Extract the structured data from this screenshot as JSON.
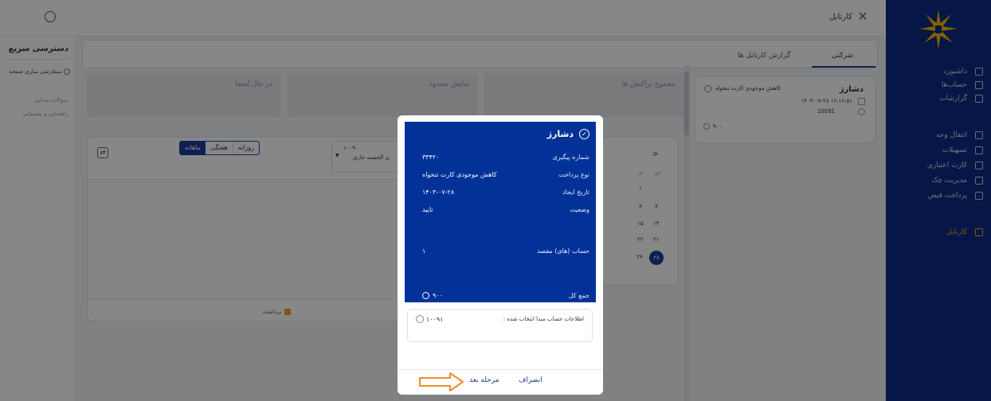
{
  "header": {
    "title": "کارتابل"
  },
  "nav": {
    "items": [
      {
        "label": "داشبورد",
        "icon": "dashboard-icon"
      },
      {
        "label": "حساب‌ها",
        "icon": "bank-icon"
      },
      {
        "label": "گزارشات",
        "icon": "report-icon"
      },
      {
        "label": "انتقال وجه",
        "icon": "transfer-icon"
      },
      {
        "label": "تسهیلات",
        "icon": "loan-icon"
      },
      {
        "label": "کارت اعتباری",
        "icon": "credit-card-icon"
      },
      {
        "label": "مدیریت چک",
        "icon": "cheque-icon"
      },
      {
        "label": "پرداخت قبض",
        "icon": "bill-icon"
      },
      {
        "label": "کارتابل",
        "icon": "cartable-icon"
      }
    ]
  },
  "quick_access": {
    "title": "دسترسی سریع",
    "customize": "سفارشی سازی صفحه",
    "faq": "سوالات متداول",
    "support": "راهنمایی و پشتیبانی"
  },
  "tabs": {
    "company": "شرکتی",
    "report": "گزارش کارتابل ها"
  },
  "list_card": {
    "title": "دشارژ",
    "subtitle": "کاهش موجودی کارت تنخواه",
    "datetime": "۱۴۰۳-۰۷-۲۸ ۱۶:۱۶:۵۱",
    "account": "10091",
    "amount": "۹۰۰"
  },
  "stats": {
    "in_progress": "در حال امضا",
    "limited": "نمایش محدود",
    "total": "مجموع تراکنش ها"
  },
  "filters": {
    "daily": "روزانه",
    "weekly": "هفتگی",
    "monthly": "ماهانه",
    "account_value": "۱۰۰۹۰",
    "account_sub": "ن الحسنه جاری"
  },
  "chart_legend": {
    "withdraw": "برداشت"
  },
  "calendar": {
    "next": ">",
    "weekday1": "ش",
    "weekday2": "ی",
    "d1": "۱",
    "d7": "۷",
    "d8": "۸",
    "d14": "۱۴",
    "d15": "۱۵",
    "d21": "۲۱",
    "d22": "۲۲",
    "d28": "۲۸",
    "d29": "۲۹"
  },
  "modal": {
    "title": "دشارژ",
    "tracking_label": "شماره پیگیری",
    "tracking_value": "۳۳۴۲۰",
    "payment_type_label": "نوع پرداخت",
    "payment_type_value": "کاهش موجودی کارت تنخواه",
    "created_label": "تاریخ ایجاد",
    "created_value": "۱۴۰۳-۰۷-۲۸",
    "status_label": "وضعیت",
    "status_value": "تایید",
    "dest_label": "حساب (های) مقصد",
    "dest_value": "۱",
    "total_label": "جمع کل",
    "total_value": "۹۰۰",
    "source_label": "اطلاعات حساب مبدا انتخاب شده :",
    "source_value": "۱۰۰۹۱",
    "next_button": "مرحله بعد",
    "cancel_button": "انصراف"
  },
  "colors": {
    "nav_bg": "#0c2a84",
    "modal_blue": "#023298",
    "accent": "#1b3c9c",
    "arrow": "#f08c2a",
    "legend_withdraw": "#f0a020"
  }
}
